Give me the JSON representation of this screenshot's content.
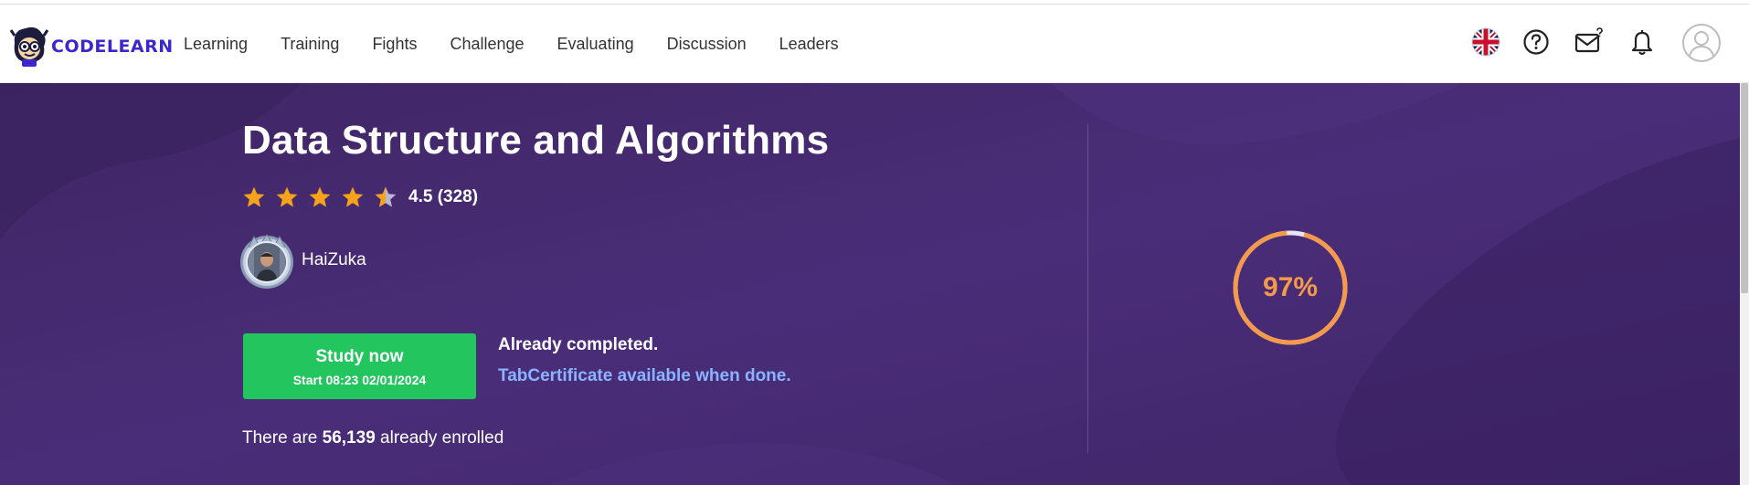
{
  "app": {
    "logo_text": "CODELEARN"
  },
  "nav": {
    "items": [
      "Learning",
      "Training",
      "Fights",
      "Challenge",
      "Evaluating",
      "Discussion",
      "Leaders"
    ]
  },
  "header_icons": [
    "uk-flag-icon",
    "help-icon",
    "messages-icon",
    "bell-icon",
    "user-icon"
  ],
  "course": {
    "title": "Data Structure and Algorithms",
    "rating_text": "4.5 (328)",
    "rating_value": 4.5,
    "rating_max": 5,
    "author_name": "HaiZuka",
    "study_button_label": "Study now",
    "study_start": "Start 08:23 02/01/2024",
    "status_text": "Already completed.",
    "certificate_text": "TabCertificate available when done.",
    "enrolled_prefix": "There are ",
    "enrolled_count": "56,139",
    "enrolled_suffix": " already enrolled",
    "progress_text": "97%",
    "progress_value": 0.97
  },
  "colors": {
    "brand": "#3b28cc",
    "hero_bg": "#43286e",
    "star": "#f7a21b",
    "study_button": "#22c55e",
    "link": "#8ab4ff",
    "progress": "#f59a4a"
  }
}
